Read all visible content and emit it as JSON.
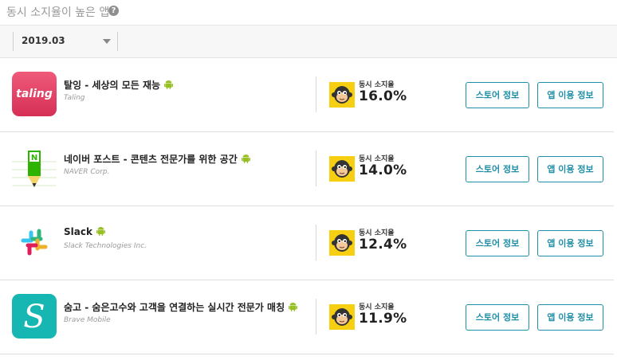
{
  "header": {
    "title": "동시 소지율이 높은 앱",
    "help_icon": "?"
  },
  "filter": {
    "selected_month": "2019.03"
  },
  "colors": {
    "accent": "#1f8ea6",
    "android_green": "#97c024",
    "badge_yellow": "#f6cf12"
  },
  "apps": [
    {
      "name": "탈잉 - 세상의 모든 재능",
      "developer": "Taling",
      "stat_label": "동시 소지율",
      "stat_value": "16.0%",
      "store_button": "스토어 정보",
      "usage_button": "앱 이용 정보",
      "icon": "taling-app-icon",
      "icon_text": "taling"
    },
    {
      "name": "네이버 포스트 - 콘텐츠 전문가를 위한 공간",
      "developer": "NAVER Corp.",
      "stat_label": "동시 소지율",
      "stat_value": "14.0%",
      "store_button": "스토어 정보",
      "usage_button": "앱 이용 정보",
      "icon": "naver-post-app-icon",
      "icon_text": "N"
    },
    {
      "name": "Slack",
      "developer": "Slack Technologies Inc.",
      "stat_label": "동시 소지율",
      "stat_value": "12.4%",
      "store_button": "스토어 정보",
      "usage_button": "앱 이용 정보",
      "icon": "slack-app-icon"
    },
    {
      "name": "숨고 - 숨은고수와 고객을 연결하는 실시간 전문가 매칭",
      "developer": "Brave Mobile",
      "stat_label": "동시 소지율",
      "stat_value": "11.9%",
      "store_button": "스토어 정보",
      "usage_button": "앱 이용 정보",
      "icon": "soomgo-app-icon",
      "icon_text": "S"
    }
  ]
}
